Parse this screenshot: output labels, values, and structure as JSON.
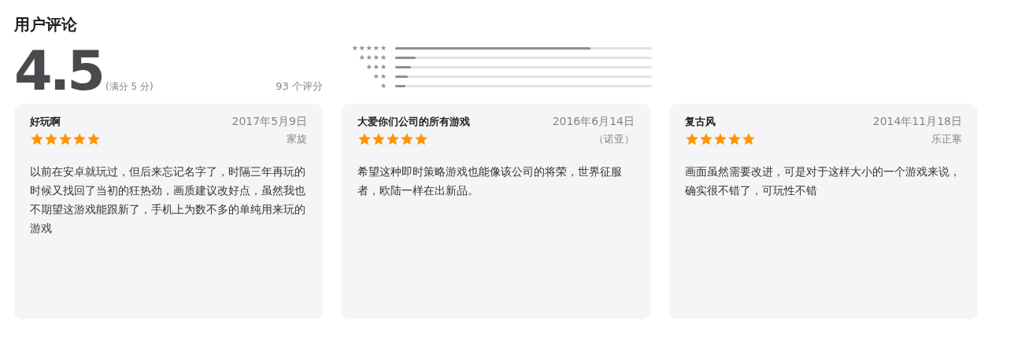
{
  "heading": "用户评论",
  "summary": {
    "score": "4.5",
    "out_of": "(满分 5 分)",
    "count": "93 个评分"
  },
  "histogram": [
    {
      "label": "★★★★★",
      "level": 0.76
    },
    {
      "label": "★★★★",
      "level": 0.08
    },
    {
      "label": "★★★",
      "level": 0.06
    },
    {
      "label": "★★",
      "level": 0.05
    },
    {
      "label": "★",
      "level": 0.04
    }
  ],
  "reviews": [
    {
      "title": "好玩啊",
      "date": "2017年5月9日",
      "stars": 5,
      "author": "家旋",
      "body": "以前在安卓就玩过，但后来忘记名字了，时隔三年再玩的时候又找回了当初的狂热劲，画质建议改好点，虽然我也不期望这游戏能跟新了，手机上为数不多的单纯用来玩的游戏"
    },
    {
      "title": "大爱你们公司的所有游戏",
      "date": "2016年6月14日",
      "stars": 5,
      "author": "（诺亚）",
      "body": "希望这种即时策略游戏也能像该公司的将荣，世界征服者，欧陆一样在出新品。"
    },
    {
      "title": "复古风",
      "date": "2014年11月18日",
      "stars": 5,
      "author": "乐正寒",
      "body": "画面虽然需要改进，可是对于这样大小的一个游戏来说，确实很不错了，可玩性不错"
    }
  ]
}
